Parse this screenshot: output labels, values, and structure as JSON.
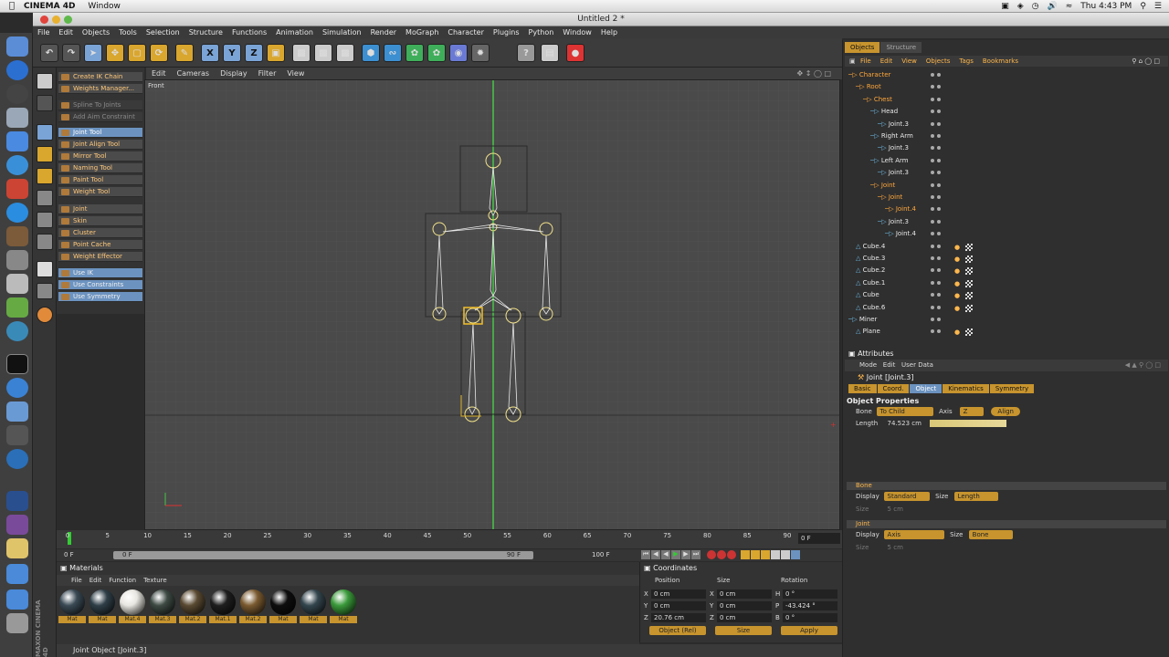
{
  "mac_menubar": {
    "app": "CINEMA 4D",
    "menu": "Window",
    "clock": "Thu 4:43 PM"
  },
  "window": {
    "title": "Untitled 2 *"
  },
  "main_menu": [
    "File",
    "Edit",
    "Objects",
    "Tools",
    "Selection",
    "Structure",
    "Functions",
    "Animation",
    "Simulation",
    "Render",
    "MoGraph",
    "Character",
    "Plugins",
    "Python",
    "Window",
    "Help"
  ],
  "toolbar": {
    "axis_x": "X",
    "axis_y": "Y",
    "axis_z": "Z"
  },
  "character_panel": {
    "items": [
      {
        "label": "Create IK Chain",
        "style": "normal"
      },
      {
        "label": "Weights Manager...",
        "style": "normal"
      },
      {
        "label": "Spline To Joints",
        "style": "dim"
      },
      {
        "label": "Add Aim Constraint",
        "style": "dim"
      },
      {
        "label": "Joint Tool",
        "style": "blue"
      },
      {
        "label": "Joint Align Tool",
        "style": "normal"
      },
      {
        "label": "Mirror Tool",
        "style": "normal"
      },
      {
        "label": "Naming Tool",
        "style": "normal"
      },
      {
        "label": "Paint Tool",
        "style": "normal"
      },
      {
        "label": "Weight Tool",
        "style": "normal"
      },
      {
        "label": "Joint",
        "style": "normal"
      },
      {
        "label": "Skin",
        "style": "normal"
      },
      {
        "label": "Cluster",
        "style": "normal"
      },
      {
        "label": "Point Cache",
        "style": "normal"
      },
      {
        "label": "Weight Effector",
        "style": "normal"
      },
      {
        "label": "Use IK",
        "style": "blue"
      },
      {
        "label": "Use Constraints",
        "style": "blue"
      },
      {
        "label": "Use Symmetry",
        "style": "blue"
      }
    ]
  },
  "viewport": {
    "menu": [
      "Edit",
      "Cameras",
      "Display",
      "Filter",
      "View"
    ],
    "view_name": "Front"
  },
  "timeline": {
    "ticks": [
      "0",
      "5",
      "10",
      "15",
      "20",
      "25",
      "30",
      "35",
      "40",
      "45",
      "50",
      "55",
      "60",
      "65",
      "70",
      "75",
      "80",
      "85",
      "90"
    ],
    "current_frame_display": "0 F",
    "start": "0 F",
    "range_start": "0 F",
    "range_end": "90 F",
    "end": "100 F"
  },
  "materials": {
    "title": "Materials",
    "menu": [
      "File",
      "Edit",
      "Function",
      "Texture"
    ],
    "items": [
      {
        "label": "Mat",
        "color": "#3a4a55"
      },
      {
        "label": "Mat",
        "color": "#2f3f48"
      },
      {
        "label": "Mat.4",
        "color": "#e8e6e0"
      },
      {
        "label": "Mat.3",
        "color": "#3e4a44"
      },
      {
        "label": "Mat.2",
        "color": "#5a4a32"
      },
      {
        "label": "Mat.1",
        "color": "#1e1e1e"
      },
      {
        "label": "Mat.2",
        "color": "#7a5a30"
      },
      {
        "label": "Mat",
        "color": "#0e0e0e"
      },
      {
        "label": "Mat",
        "color": "#34464e"
      },
      {
        "label": "Mat",
        "color": "#3a9a3a"
      }
    ]
  },
  "coordinates": {
    "title": "Coordinates",
    "headers": [
      "Position",
      "Size",
      "Rotation"
    ],
    "rows": [
      {
        "axis": "X",
        "pos": "0 cm",
        "size_axis": "X",
        "size": "0 cm",
        "rot_axis": "H",
        "rot": "0 °"
      },
      {
        "axis": "Y",
        "pos": "0 cm",
        "size_axis": "Y",
        "size": "0 cm",
        "rot_axis": "P",
        "rot": "-43.424 °"
      },
      {
        "axis": "Z",
        "pos": "20.76 cm",
        "size_axis": "Z",
        "size": "0 cm",
        "rot_axis": "B",
        "rot": "0 °"
      }
    ],
    "mode1": "Object (Rel)",
    "mode2": "Size",
    "apply": "Apply"
  },
  "status": "Joint Object [Joint.3]",
  "object_manager": {
    "tabs": [
      "Objects",
      "Structure"
    ],
    "menu": [
      "File",
      "Edit",
      "View",
      "Objects",
      "Tags",
      "Bookmarks"
    ],
    "rows": [
      {
        "label": "Character",
        "indent": 0,
        "sel": true
      },
      {
        "label": "Root",
        "indent": 1,
        "sel": true
      },
      {
        "label": "Chest",
        "indent": 2,
        "sel": true
      },
      {
        "label": "Head",
        "indent": 3,
        "sel": false
      },
      {
        "label": "Joint.3",
        "indent": 4,
        "sel": false
      },
      {
        "label": "Right Arm",
        "indent": 3,
        "sel": false
      },
      {
        "label": "Joint.3",
        "indent": 4,
        "sel": false
      },
      {
        "label": "Left Arm",
        "indent": 3,
        "sel": false
      },
      {
        "label": "Joint.3",
        "indent": 4,
        "sel": false
      },
      {
        "label": "Joint",
        "indent": 3,
        "sel": true
      },
      {
        "label": "Joint",
        "indent": 4,
        "sel": true
      },
      {
        "label": "Joint.4",
        "indent": 5,
        "sel": true
      },
      {
        "label": "Joint.3",
        "indent": 4,
        "sel": false
      },
      {
        "label": "Joint.4",
        "indent": 5,
        "sel": false
      },
      {
        "label": "Cube.4",
        "indent": 1,
        "sel": false
      },
      {
        "label": "Cube.3",
        "indent": 1,
        "sel": false
      },
      {
        "label": "Cube.2",
        "indent": 1,
        "sel": false
      },
      {
        "label": "Cube.1",
        "indent": 1,
        "sel": false
      },
      {
        "label": "Cube",
        "indent": 1,
        "sel": false
      },
      {
        "label": "Cube.6",
        "indent": 1,
        "sel": false
      },
      {
        "label": "Miner",
        "indent": 0,
        "sel": false
      },
      {
        "label": "Plane",
        "indent": 1,
        "sel": false
      }
    ]
  },
  "attributes": {
    "title": "Attributes",
    "menu": [
      "Mode",
      "Edit",
      "User Data"
    ],
    "object_name": "Joint [Joint.3]",
    "tabs": [
      "Basic",
      "Coord.",
      "Object",
      "Kinematics",
      "Symmetry"
    ],
    "section": "Object Properties",
    "bone_label": "Bone",
    "bone_value": "To Child",
    "axis_label": "Axis",
    "axis_value": "Z",
    "align": "Align",
    "length_label": "Length",
    "length_value": "74.523 cm",
    "bone_section": "Bone",
    "bone_display_label": "Display",
    "bone_display_value": "Standard",
    "bone_size_label": "Size",
    "bone_size_value": "Length",
    "bone_size2_label": "Size",
    "bone_size2_value": "5 cm",
    "joint_section": "Joint",
    "joint_display_label": "Display",
    "joint_display_value": "Axis",
    "joint_size_label": "Size",
    "joint_size_value": "Bone",
    "joint_size2_label": "Size",
    "joint_size2_value": "5 cm"
  },
  "colors": {
    "accent": "#c7942e",
    "selection": "#6c93c0",
    "joint": "#f2e28a",
    "axis": "#47c447"
  }
}
